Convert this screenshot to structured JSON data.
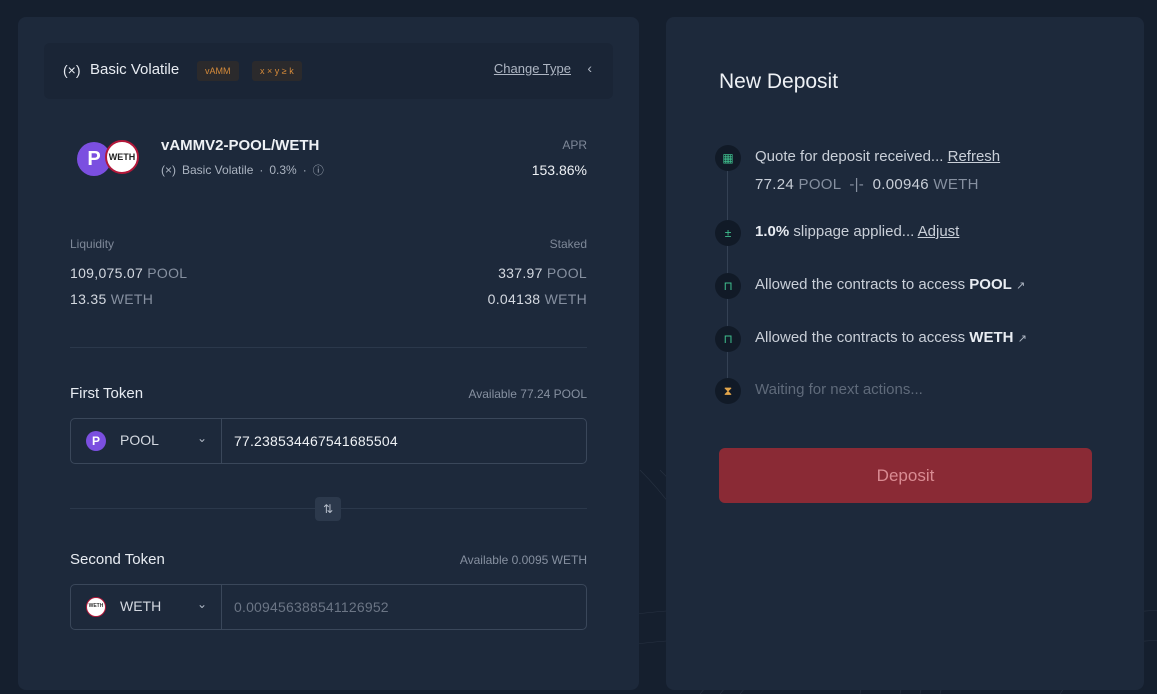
{
  "pool_type": {
    "title": "Basic Volatile",
    "badge_amm": "vAMM",
    "badge_formula": "x × y ≥ k",
    "change_label": "Change Type"
  },
  "pool": {
    "pair": "vAMMV2-POOL/WETH",
    "type": "Basic Volatile",
    "fee": "0.3%",
    "token_a_logo": "P",
    "token_b_logo": "WETH",
    "apr_label": "APR",
    "apr_value": "153.86%"
  },
  "liquidity": {
    "label": "Liquidity",
    "amount_a": "109,075.07",
    "unit_a": "POOL",
    "amount_b": "13.35",
    "unit_b": "WETH"
  },
  "staked": {
    "label": "Staked",
    "amount_a": "337.97",
    "unit_a": "POOL",
    "amount_b": "0.04138",
    "unit_b": "WETH"
  },
  "first_token": {
    "label": "First Token",
    "available": "Available 77.24 POOL",
    "symbol": "POOL",
    "icon_text": "P",
    "value": "77.238534467541685504"
  },
  "second_token": {
    "label": "Second Token",
    "available": "Available 0.0095 WETH",
    "symbol": "WETH",
    "icon_text": "WETH",
    "placeholder": "0.009456388541126952"
  },
  "deposit": {
    "title": "New Deposit",
    "steps": {
      "quote_text": "Quote for deposit received...",
      "quote_link": "Refresh",
      "quote_a": "77.24",
      "quote_a_unit": "POOL",
      "quote_b": "0.00946",
      "quote_b_unit": "WETH",
      "slippage_value": "1.0%",
      "slippage_text": "slippage applied...",
      "slippage_link": "Adjust",
      "allow_text": "Allowed the contracts to access",
      "allow_a_token": "POOL",
      "allow_b_token": "WETH",
      "waiting_text": "Waiting for next actions..."
    },
    "button_label": "Deposit"
  },
  "colors": {
    "background": "#151f2e",
    "panel": "#1d293b",
    "accent_green": "#3fbf8e",
    "accent_orange": "#d68b3a",
    "deposit_button": "#8a2a35",
    "pool_purple": "#7b4fe0"
  }
}
